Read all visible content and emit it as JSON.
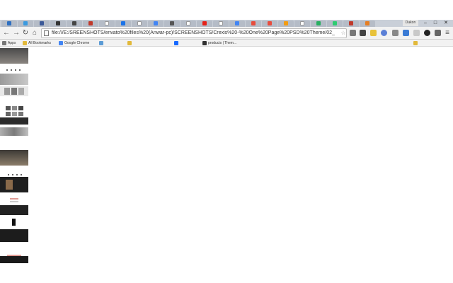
{
  "browser": {
    "url": "file:///E:/SREENSHOTS/envato%20files%20(Anwar-pc)/SCREENSHOTS/Crexis%20-%20One%20Page%20PSD%20Theme/02_",
    "window_label": "Dukon",
    "tabs": [
      {
        "icon": "chart-icon",
        "color": "#2d6fc1"
      },
      {
        "icon": "twitter-icon",
        "color": "#3a9ae0"
      },
      {
        "icon": "facebook-icon",
        "color": "#3b5998"
      },
      {
        "icon": "github-icon",
        "color": "#333333"
      },
      {
        "icon": "circle-icon",
        "color": "#444444"
      },
      {
        "icon": "record-icon",
        "color": "#c0392b"
      },
      {
        "icon": "page-icon",
        "color": "#ffffff"
      },
      {
        "icon": "doc-icon",
        "color": "#1a73e8"
      },
      {
        "icon": "page-icon",
        "color": "#ffffff"
      },
      {
        "icon": "google-icon",
        "color": "#4285f4"
      },
      {
        "icon": "dark-page-icon",
        "color": "#555555"
      },
      {
        "icon": "page-icon",
        "color": "#ffffff"
      },
      {
        "icon": "youtube-icon",
        "color": "#e62117"
      },
      {
        "icon": "page-icon",
        "color": "#ffffff"
      },
      {
        "icon": "google-icon",
        "color": "#4285f4"
      },
      {
        "icon": "c-icon",
        "color": "#e74c3c"
      },
      {
        "icon": "record-icon",
        "color": "#e84c3d"
      },
      {
        "icon": "orange-icon",
        "color": "#f39c12"
      },
      {
        "icon": "page-icon",
        "color": "#ffffff"
      },
      {
        "icon": "green-icon",
        "color": "#27ae60"
      },
      {
        "icon": "green-icon",
        "color": "#2ecc71"
      },
      {
        "icon": "red-icon",
        "color": "#c0392b"
      },
      {
        "icon": "orange-icon",
        "color": "#e67e22"
      }
    ]
  },
  "bookmarks": {
    "apps": "Apps",
    "all_bookmarks": "All Bookmarks",
    "google": "Google Chrome",
    "products": "products | Them..."
  }
}
